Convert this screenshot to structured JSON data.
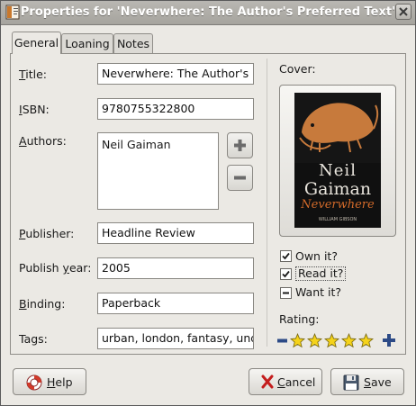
{
  "window": {
    "title": "Properties for 'Neverwhere: The Author's Preferred Text'"
  },
  "tabs": [
    {
      "label": "General",
      "active": true
    },
    {
      "label": "Loaning",
      "active": false
    },
    {
      "label": "Notes",
      "active": false
    }
  ],
  "fields": {
    "title": {
      "label_mn": "T",
      "label_rest": "itle:",
      "value": "Neverwhere: The Author's Preferred Text"
    },
    "isbn": {
      "label_mn": "I",
      "label_rest": "SBN:",
      "value": "9780755322800"
    },
    "authors": {
      "label_mn": "A",
      "label_rest": "uthors:",
      "value": "Neil Gaiman"
    },
    "publisher": {
      "label_mn": "P",
      "label_rest": "ublisher:",
      "value": "Headline Review"
    },
    "publish_year": {
      "label_pre": "Publish ",
      "label_mn": "y",
      "label_rest": "ear:",
      "value": "2005"
    },
    "binding": {
      "label_mn": "B",
      "label_rest": "inding:",
      "value": "Paperback"
    },
    "tags": {
      "label": "Tags:",
      "value": "urban, london, fantasy, underground"
    }
  },
  "cover": {
    "label": "Cover:",
    "author_line1": "Neil",
    "author_line2": "Gaiman",
    "book_title": "Neverwhere",
    "intro_text": "WILLIAM GIBSON"
  },
  "flags": {
    "own": {
      "label": "Own it?",
      "checked": true
    },
    "read": {
      "label": "Read it?",
      "checked": true
    },
    "want": {
      "label": "Want it?",
      "state": "indeterminate"
    }
  },
  "rating": {
    "label": "Rating:",
    "stars": 5,
    "max": 5
  },
  "buttons": {
    "help": {
      "mn": "H",
      "rest": "elp"
    },
    "cancel": {
      "mn": "C",
      "rest": "ancel"
    },
    "save": {
      "mn": "S",
      "rest": "ave"
    }
  },
  "icons": {
    "app": "book-properties-icon",
    "close": "close-icon",
    "add": "plus-icon",
    "remove": "minus-icon",
    "help": "lifebuoy-icon",
    "cancel": "red-x-icon",
    "save": "floppy-disk-icon",
    "rating_decrease": "minus-icon",
    "rating_increase": "plus-icon",
    "star": "star-icon"
  },
  "colors": {
    "star_fill": "#f5d31a",
    "rating_button": "#2c4a86",
    "cancel_x": "#c41d1d",
    "cover_title": "#d26a2a"
  }
}
